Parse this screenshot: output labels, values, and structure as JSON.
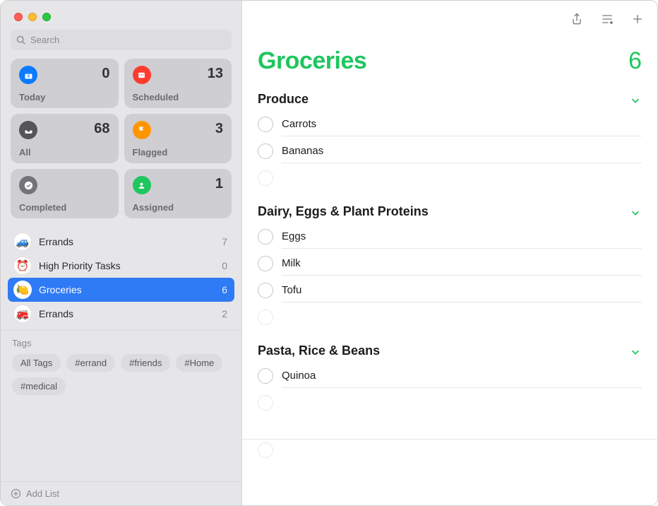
{
  "search": {
    "placeholder": "Search"
  },
  "smartLists": {
    "today": {
      "label": "Today",
      "count": "0"
    },
    "scheduled": {
      "label": "Scheduled",
      "count": "13"
    },
    "all": {
      "label": "All",
      "count": "68"
    },
    "flagged": {
      "label": "Flagged",
      "count": "3"
    },
    "completed": {
      "label": "Completed",
      "count": ""
    },
    "assigned": {
      "label": "Assigned",
      "count": "1"
    }
  },
  "lists": [
    {
      "name": "Errands",
      "count": "7",
      "emoji": "🚙",
      "selected": false
    },
    {
      "name": "High Priority Tasks",
      "count": "0",
      "emoji": "⏰",
      "selected": false
    },
    {
      "name": "Groceries",
      "count": "6",
      "emoji": "🍋",
      "selected": true
    },
    {
      "name": "Errands",
      "count": "2",
      "emoji": "🚒",
      "selected": false
    }
  ],
  "tagsHeader": "Tags",
  "tags": [
    "All Tags",
    "#errand",
    "#friends",
    "#Home",
    "#medical"
  ],
  "addListLabel": "Add List",
  "main": {
    "title": "Groceries",
    "count": "6",
    "accentColor": "#1fc65e",
    "sections": [
      {
        "title": "Produce",
        "items": [
          "Carrots",
          "Bananas"
        ]
      },
      {
        "title": "Dairy, Eggs & Plant Proteins",
        "items": [
          "Eggs",
          "Milk",
          "Tofu"
        ]
      },
      {
        "title": "Pasta, Rice & Beans",
        "items": [
          "Quinoa"
        ]
      }
    ]
  }
}
